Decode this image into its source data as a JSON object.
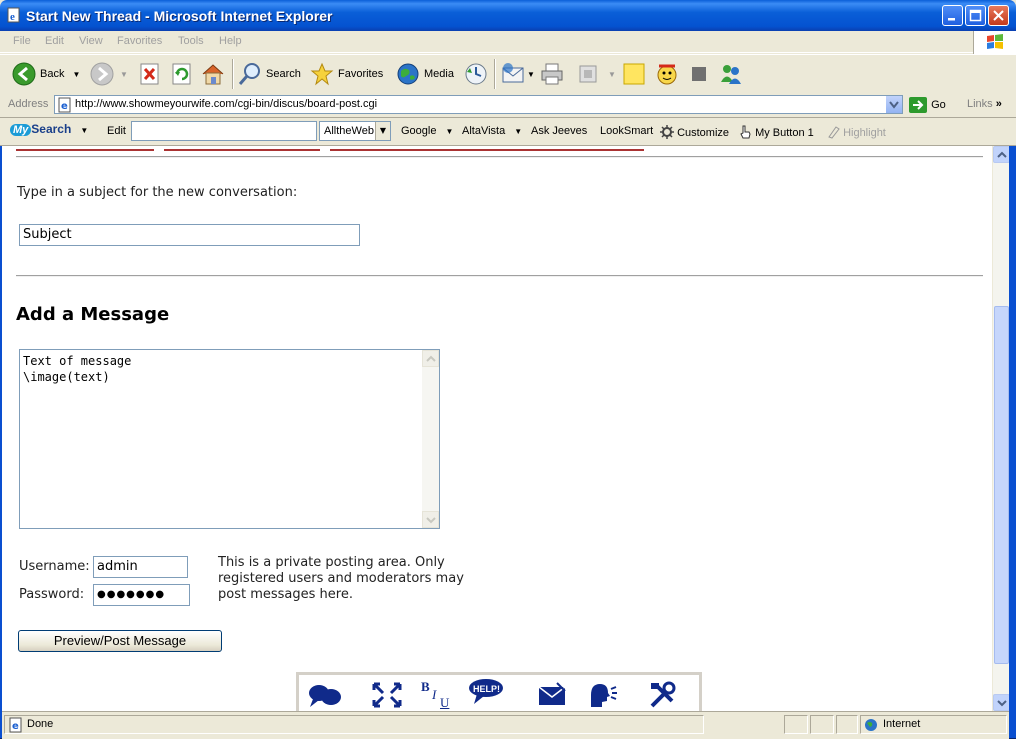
{
  "window": {
    "title": "Start New Thread - Microsoft Internet Explorer"
  },
  "menu": [
    "File",
    "Edit",
    "View",
    "Favorites",
    "Tools",
    "Help"
  ],
  "toolbar": {
    "back": "Back",
    "search": "Search",
    "favorites": "Favorites",
    "media": "Media"
  },
  "address": {
    "label": "Address",
    "url": "http://www.showmeyourwife.com/cgi-bin/discus/board-post.cgi",
    "go": "Go",
    "links": "Links"
  },
  "searchbar": {
    "brand_my": "My",
    "brand_search": "Search",
    "edit": "Edit",
    "engine": "AlltheWeb",
    "google": "Google",
    "altavista": "AltaVista",
    "askjeeves": "Ask Jeeves",
    "looksmart": "LookSmart",
    "customize": "Customize",
    "mybutton": "My Button 1",
    "highlight": "Highlight"
  },
  "form": {
    "subject_prompt": "Type in a subject for the new conversation:",
    "subject_value": "Subject",
    "message_heading": "Add a Message",
    "message_text": "Text of message\n\\image(text)",
    "username_label": "Username:",
    "username_value": "admin",
    "password_label": "Password:",
    "password_value": "●●●●●●●",
    "note": "This is a private posting area. Only registered users and moderators may post messages here.",
    "submit_label": "Preview/Post Message"
  },
  "formatting_icons": [
    "chat-bubbles-icon",
    "resize-arrows-icon",
    "bold-italic-underline-icon",
    "help-bubble-icon",
    "envelope-icon",
    "speaking-head-icon",
    "tools-icon"
  ],
  "help_icon_text": "HELP!",
  "status": {
    "text": "Done",
    "zone": "Internet"
  }
}
